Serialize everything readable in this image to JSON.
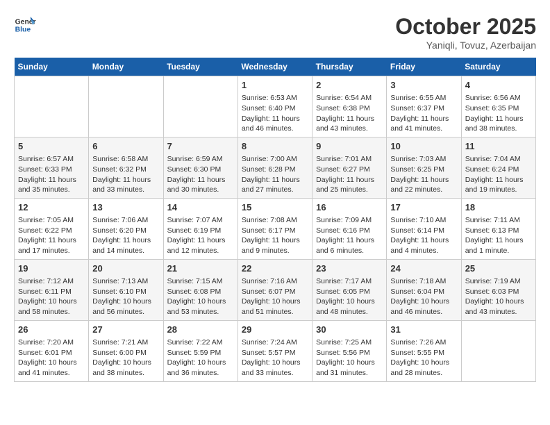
{
  "header": {
    "logo_line1": "General",
    "logo_line2": "Blue",
    "month": "October 2025",
    "location": "Yaniqli, Tovuz, Azerbaijan"
  },
  "days_of_week": [
    "Sunday",
    "Monday",
    "Tuesday",
    "Wednesday",
    "Thursday",
    "Friday",
    "Saturday"
  ],
  "weeks": [
    [
      {
        "num": "",
        "text": ""
      },
      {
        "num": "",
        "text": ""
      },
      {
        "num": "",
        "text": ""
      },
      {
        "num": "1",
        "text": "Sunrise: 6:53 AM\nSunset: 6:40 PM\nDaylight: 11 hours and 46 minutes."
      },
      {
        "num": "2",
        "text": "Sunrise: 6:54 AM\nSunset: 6:38 PM\nDaylight: 11 hours and 43 minutes."
      },
      {
        "num": "3",
        "text": "Sunrise: 6:55 AM\nSunset: 6:37 PM\nDaylight: 11 hours and 41 minutes."
      },
      {
        "num": "4",
        "text": "Sunrise: 6:56 AM\nSunset: 6:35 PM\nDaylight: 11 hours and 38 minutes."
      }
    ],
    [
      {
        "num": "5",
        "text": "Sunrise: 6:57 AM\nSunset: 6:33 PM\nDaylight: 11 hours and 35 minutes."
      },
      {
        "num": "6",
        "text": "Sunrise: 6:58 AM\nSunset: 6:32 PM\nDaylight: 11 hours and 33 minutes."
      },
      {
        "num": "7",
        "text": "Sunrise: 6:59 AM\nSunset: 6:30 PM\nDaylight: 11 hours and 30 minutes."
      },
      {
        "num": "8",
        "text": "Sunrise: 7:00 AM\nSunset: 6:28 PM\nDaylight: 11 hours and 27 minutes."
      },
      {
        "num": "9",
        "text": "Sunrise: 7:01 AM\nSunset: 6:27 PM\nDaylight: 11 hours and 25 minutes."
      },
      {
        "num": "10",
        "text": "Sunrise: 7:03 AM\nSunset: 6:25 PM\nDaylight: 11 hours and 22 minutes."
      },
      {
        "num": "11",
        "text": "Sunrise: 7:04 AM\nSunset: 6:24 PM\nDaylight: 11 hours and 19 minutes."
      }
    ],
    [
      {
        "num": "12",
        "text": "Sunrise: 7:05 AM\nSunset: 6:22 PM\nDaylight: 11 hours and 17 minutes."
      },
      {
        "num": "13",
        "text": "Sunrise: 7:06 AM\nSunset: 6:20 PM\nDaylight: 11 hours and 14 minutes."
      },
      {
        "num": "14",
        "text": "Sunrise: 7:07 AM\nSunset: 6:19 PM\nDaylight: 11 hours and 12 minutes."
      },
      {
        "num": "15",
        "text": "Sunrise: 7:08 AM\nSunset: 6:17 PM\nDaylight: 11 hours and 9 minutes."
      },
      {
        "num": "16",
        "text": "Sunrise: 7:09 AM\nSunset: 6:16 PM\nDaylight: 11 hours and 6 minutes."
      },
      {
        "num": "17",
        "text": "Sunrise: 7:10 AM\nSunset: 6:14 PM\nDaylight: 11 hours and 4 minutes."
      },
      {
        "num": "18",
        "text": "Sunrise: 7:11 AM\nSunset: 6:13 PM\nDaylight: 11 hours and 1 minute."
      }
    ],
    [
      {
        "num": "19",
        "text": "Sunrise: 7:12 AM\nSunset: 6:11 PM\nDaylight: 10 hours and 58 minutes."
      },
      {
        "num": "20",
        "text": "Sunrise: 7:13 AM\nSunset: 6:10 PM\nDaylight: 10 hours and 56 minutes."
      },
      {
        "num": "21",
        "text": "Sunrise: 7:15 AM\nSunset: 6:08 PM\nDaylight: 10 hours and 53 minutes."
      },
      {
        "num": "22",
        "text": "Sunrise: 7:16 AM\nSunset: 6:07 PM\nDaylight: 10 hours and 51 minutes."
      },
      {
        "num": "23",
        "text": "Sunrise: 7:17 AM\nSunset: 6:05 PM\nDaylight: 10 hours and 48 minutes."
      },
      {
        "num": "24",
        "text": "Sunrise: 7:18 AM\nSunset: 6:04 PM\nDaylight: 10 hours and 46 minutes."
      },
      {
        "num": "25",
        "text": "Sunrise: 7:19 AM\nSunset: 6:03 PM\nDaylight: 10 hours and 43 minutes."
      }
    ],
    [
      {
        "num": "26",
        "text": "Sunrise: 7:20 AM\nSunset: 6:01 PM\nDaylight: 10 hours and 41 minutes."
      },
      {
        "num": "27",
        "text": "Sunrise: 7:21 AM\nSunset: 6:00 PM\nDaylight: 10 hours and 38 minutes."
      },
      {
        "num": "28",
        "text": "Sunrise: 7:22 AM\nSunset: 5:59 PM\nDaylight: 10 hours and 36 minutes."
      },
      {
        "num": "29",
        "text": "Sunrise: 7:24 AM\nSunset: 5:57 PM\nDaylight: 10 hours and 33 minutes."
      },
      {
        "num": "30",
        "text": "Sunrise: 7:25 AM\nSunset: 5:56 PM\nDaylight: 10 hours and 31 minutes."
      },
      {
        "num": "31",
        "text": "Sunrise: 7:26 AM\nSunset: 5:55 PM\nDaylight: 10 hours and 28 minutes."
      },
      {
        "num": "",
        "text": ""
      }
    ]
  ]
}
